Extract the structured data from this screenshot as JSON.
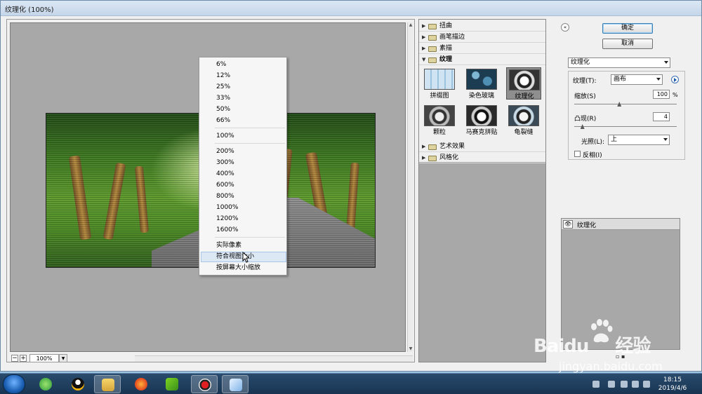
{
  "window": {
    "title": "纹理化 (100%)"
  },
  "preview": {
    "zoom_value": "100%",
    "zoom_out": "−",
    "zoom_in": "+"
  },
  "zoom_menu": {
    "group1": [
      "6%",
      "12%",
      "25%",
      "33%",
      "50%",
      "66%"
    ],
    "group2": [
      "100%"
    ],
    "group3": [
      "200%",
      "300%",
      "400%",
      "600%",
      "800%",
      "1000%",
      "1200%",
      "1600%"
    ],
    "group4": [
      "实际像素",
      "符合视图大小",
      "按屏幕大小缩放"
    ],
    "highlighted": "符合视图大小"
  },
  "gallery": {
    "categories_top": [
      "扭曲",
      "画笔描边",
      "素描"
    ],
    "open_category": "纹理",
    "thumbnails": [
      "拼缀图",
      "染色玻璃",
      "纹理化",
      "颗粒",
      "马赛克拼贴",
      "龟裂缝"
    ],
    "selected": "纹理化",
    "categories_bottom": [
      "艺术效果",
      "风格化"
    ]
  },
  "buttons": {
    "ok": "确定",
    "cancel": "取消"
  },
  "settings": {
    "filter_select": "纹理化",
    "texture_label": "纹理(T):",
    "texture_value": "画布",
    "scaling_label": "缩放(S)",
    "scaling_value": "100",
    "scaling_unit": "%",
    "scaling_fraction": 0.44,
    "relief_label": "凸现(R)",
    "relief_value": "4",
    "relief_fraction": 0.08,
    "light_label": "光照(L):",
    "light_value": "上",
    "invert_label": "反相(I)",
    "invert_checked": false
  },
  "layers": {
    "items": [
      "纹理化"
    ]
  },
  "watermark": {
    "brand": "Baidu",
    "brand_cn": "经验",
    "url": "jingyan.baidu.com"
  },
  "taskbar": {
    "time": "18:15",
    "date": "2019/4/6"
  },
  "colors": {
    "accent": "#3c7fb1",
    "preview_bg": "#a8a8a8",
    "menu_highlight": "#dde8f5"
  }
}
